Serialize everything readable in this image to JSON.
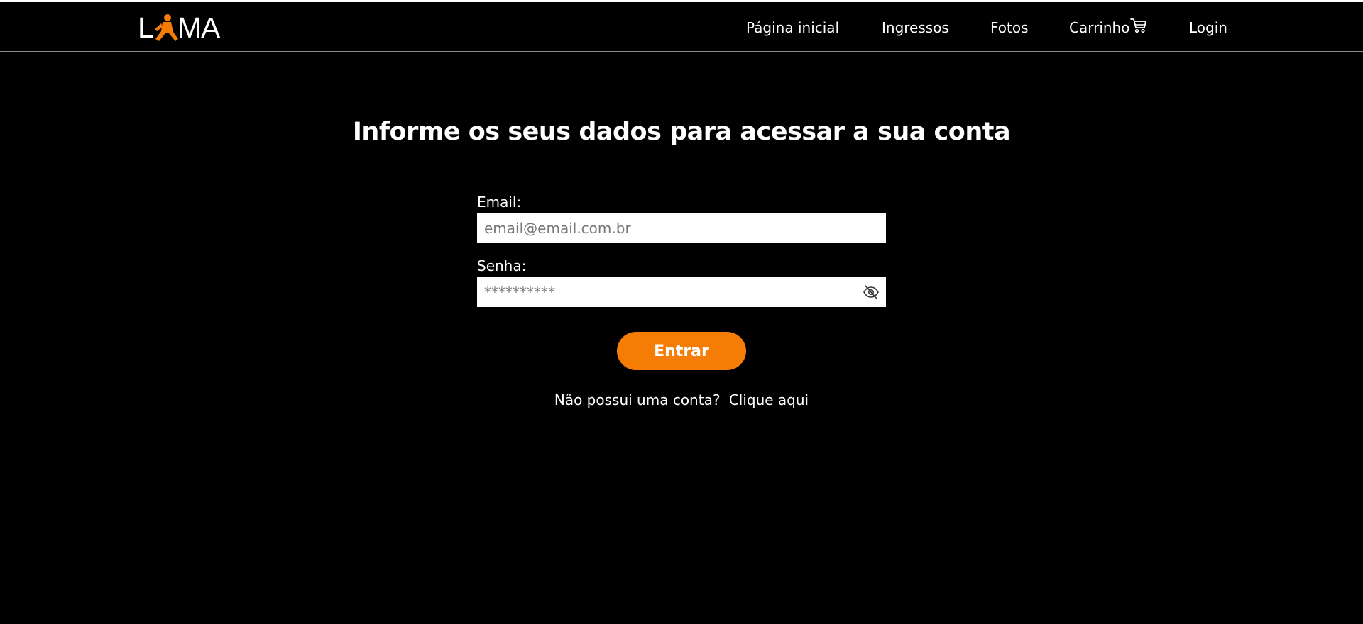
{
  "brand": {
    "logo_left": "L",
    "logo_right": "MA",
    "accent_color": "#f57c05"
  },
  "nav": {
    "items": [
      {
        "label": "Página inicial"
      },
      {
        "label": "Ingressos"
      },
      {
        "label": "Fotos"
      },
      {
        "label": "Carrinho",
        "icon": "cart-icon"
      },
      {
        "label": "Login"
      }
    ]
  },
  "login": {
    "title": "Informe os seus dados para acessar a sua conta",
    "email_label": "Email:",
    "email_placeholder": "email@email.com.br",
    "password_label": "Senha:",
    "password_placeholder": "**********",
    "password_toggle_icon": "eye-off-icon",
    "submit_label": "Entrar",
    "signup_prompt": "Não possui uma conta?",
    "signup_link": "Clique aqui"
  }
}
